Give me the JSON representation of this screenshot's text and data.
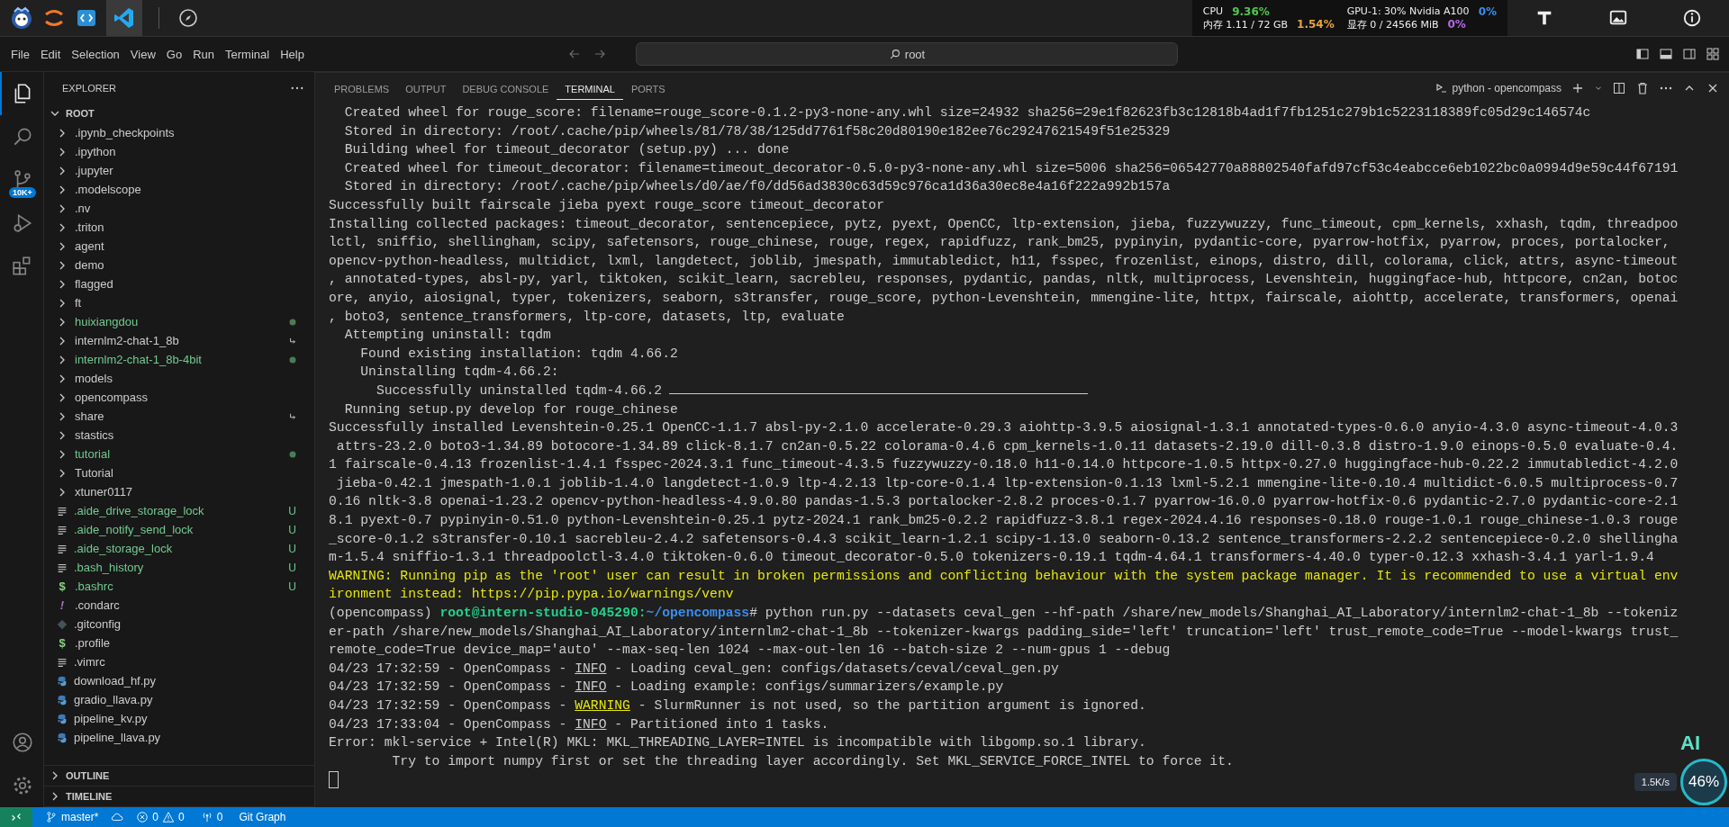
{
  "top_bar": {
    "stats": [
      {
        "label": "CPU",
        "value": "9.36%",
        "color": "#4ec94e"
      },
      {
        "label": "GPU-1: 30% Nvidia A100",
        "value": "0%",
        "color": "#3b8eea"
      },
      {
        "label": "内存 1.11 / 72 GB",
        "value": "1.54%",
        "color": "#e8a33d"
      },
      {
        "label": "显存 0 / 24566 MiB",
        "value": "0%",
        "color": "#b36ae2"
      }
    ]
  },
  "menu": [
    "File",
    "Edit",
    "Selection",
    "View",
    "Go",
    "Run",
    "Terminal",
    "Help"
  ],
  "command_center": {
    "value": "root"
  },
  "activity_bar": {
    "source_control_badge": "10K+"
  },
  "explorer": {
    "title": "EXPLORER",
    "root": "ROOT",
    "items": [
      {
        "label": ".ipynb_checkpoints",
        "kind": "folder",
        "modified": false
      },
      {
        "label": ".ipython",
        "kind": "folder",
        "modified": false
      },
      {
        "label": ".jupyter",
        "kind": "folder",
        "modified": false
      },
      {
        "label": ".modelscope",
        "kind": "folder",
        "modified": false
      },
      {
        "label": ".nv",
        "kind": "folder",
        "modified": false
      },
      {
        "label": ".triton",
        "kind": "folder",
        "modified": false
      },
      {
        "label": "agent",
        "kind": "folder",
        "modified": false
      },
      {
        "label": "demo",
        "kind": "folder",
        "modified": false
      },
      {
        "label": "flagged",
        "kind": "folder",
        "modified": false
      },
      {
        "label": "ft",
        "kind": "folder",
        "modified": false
      },
      {
        "label": "huixiangdou",
        "kind": "folder",
        "modified": true
      },
      {
        "label": "internlm2-chat-1_8b",
        "kind": "folder",
        "modified": false,
        "symlink": true
      },
      {
        "label": "internlm2-chat-1_8b-4bit",
        "kind": "folder",
        "modified": true
      },
      {
        "label": "models",
        "kind": "folder",
        "modified": false
      },
      {
        "label": "opencompass",
        "kind": "folder",
        "modified": false
      },
      {
        "label": "share",
        "kind": "folder",
        "modified": false,
        "symlink": true
      },
      {
        "label": "stastics",
        "kind": "folder",
        "modified": false
      },
      {
        "label": "tutorial",
        "kind": "folder",
        "modified": true
      },
      {
        "label": "Tutorial",
        "kind": "folder",
        "modified": false
      },
      {
        "label": "xtuner0117",
        "kind": "folder",
        "modified": false
      },
      {
        "label": ".aide_drive_storage_lock",
        "kind": "text",
        "modified": true,
        "badge": "U"
      },
      {
        "label": ".aide_notify_send_lock",
        "kind": "text",
        "modified": true,
        "badge": "U"
      },
      {
        "label": ".aide_storage_lock",
        "kind": "text",
        "modified": true,
        "badge": "U"
      },
      {
        "label": ".bash_history",
        "kind": "text",
        "modified": true,
        "badge": "U"
      },
      {
        "label": ".bashrc",
        "kind": "shell",
        "glyph": "$",
        "modified": true,
        "badge": "U"
      },
      {
        "label": ".condarc",
        "kind": "config",
        "glyph": "!",
        "modified": false
      },
      {
        "label": ".gitconfig",
        "kind": "git",
        "modified": false
      },
      {
        "label": ".profile",
        "kind": "shell",
        "glyph": "$",
        "modified": false
      },
      {
        "label": ".vimrc",
        "kind": "text",
        "modified": false
      },
      {
        "label": "download_hf.py",
        "kind": "python",
        "modified": false
      },
      {
        "label": "gradio_llava.py",
        "kind": "python",
        "modified": false
      },
      {
        "label": "pipeline_kv.py",
        "kind": "python",
        "modified": false
      },
      {
        "label": "pipeline_llava.py",
        "kind": "python",
        "modified": false
      }
    ],
    "sections": [
      "OUTLINE",
      "TIMELINE"
    ]
  },
  "panel": {
    "tabs": [
      {
        "label": "PROBLEMS",
        "selected": false
      },
      {
        "label": "OUTPUT",
        "selected": false
      },
      {
        "label": "DEBUG CONSOLE",
        "selected": false
      },
      {
        "label": "TERMINAL",
        "selected": true
      },
      {
        "label": "PORTS",
        "selected": false
      }
    ],
    "terminal_name": "python - opencompass"
  },
  "terminal": {
    "lines": [
      {
        "kind": "plain",
        "text": "  Created wheel for rouge_score: filename=rouge_score-0.1.2-py3-none-any.whl size=24932 sha256=29e1f82623fb3c12818b4ad1f7fb1251c279b1c5223118389fc05d29c146574c"
      },
      {
        "kind": "plain",
        "text": "  Stored in directory: /root/.cache/pip/wheels/81/78/38/125dd7761f58c20d80190e182ee76c29247621549f51e25329"
      },
      {
        "kind": "plain",
        "text": "  Building wheel for timeout_decorator (setup.py) ... done"
      },
      {
        "kind": "plain",
        "text": "  Created wheel for timeout_decorator: filename=timeout_decorator-0.5.0-py3-none-any.whl size=5006 sha256=06542770a88802540fafd97cf53c4eabcce6eb1022bc0a0994d9e59c44f67191"
      },
      {
        "kind": "plain",
        "text": "  Stored in directory: /root/.cache/pip/wheels/d0/ae/f0/dd56ad3830c63d59c976ca1d36a30ec8e4a16f222a992b157a"
      },
      {
        "kind": "plain",
        "text": "Successfully built fairscale jieba pyext rouge_score timeout_decorator"
      },
      {
        "kind": "plain",
        "text": "Installing collected packages: timeout_decorator, sentencepiece, pytz, pyext, OpenCC, ltp-extension, jieba, fuzzywuzzy, func_timeout, cpm_kernels, xxhash, tqdm, threadpoo"
      },
      {
        "kind": "plain",
        "text": "lctl, sniffio, shellingham, scipy, safetensors, rouge_chinese, rouge, regex, rapidfuzz, rank_bm25, pypinyin, pydantic-core, pyarrow-hotfix, pyarrow, proces, portalocker,"
      },
      {
        "kind": "plain",
        "text": "opencv-python-headless, multidict, lxml, langdetect, joblib, jmespath, immutabledict, h11, fsspec, frozenlist, einops, distro, dill, colorama, click, attrs, async-timeout"
      },
      {
        "kind": "plain",
        "text": ", annotated-types, absl-py, yarl, tiktoken, scikit_learn, sacrebleu, responses, pydantic, pandas, nltk, multiprocess, Levenshtein, huggingface-hub, httpcore, cn2an, botoc"
      },
      {
        "kind": "plain",
        "text": "ore, anyio, aiosignal, typer, tokenizers, seaborn, s3transfer, rouge_score, python-Levenshtein, mmengine-lite, httpx, fairscale, aiohttp, accelerate, transformers, openai"
      },
      {
        "kind": "plain",
        "text": ", boto3, sentence_transformers, ltp-core, datasets, ltp, evaluate"
      },
      {
        "kind": "plain",
        "text": "  Attempting uninstall: tqdm"
      },
      {
        "kind": "plain",
        "text": "    Found existing installation: tqdm 4.66.2"
      },
      {
        "kind": "plain",
        "text": "    Uninstalling tqdm-4.66.2:"
      },
      {
        "kind": "plain",
        "text": "      Successfully uninstalled tqdm-4.66.2",
        "trailing_rule": true
      },
      {
        "kind": "plain",
        "text": "  Running setup.py develop for rouge_chinese"
      },
      {
        "kind": "plain",
        "text": "Successfully installed Levenshtein-0.25.1 OpenCC-1.1.7 absl-py-2.1.0 accelerate-0.29.3 aiohttp-3.9.5 aiosignal-1.3.1 annotated-types-0.6.0 anyio-4.3.0 async-timeout-4.0.3"
      },
      {
        "kind": "plain",
        "text": " attrs-23.2.0 boto3-1.34.89 botocore-1.34.89 click-8.1.7 cn2an-0.5.22 colorama-0.4.6 cpm_kernels-1.0.11 datasets-2.19.0 dill-0.3.8 distro-1.9.0 einops-0.5.0 evaluate-0.4."
      },
      {
        "kind": "plain",
        "text": "1 fairscale-0.4.13 frozenlist-1.4.1 fsspec-2024.3.1 func_timeout-4.3.5 fuzzywuzzy-0.18.0 h11-0.14.0 httpcore-1.0.5 httpx-0.27.0 huggingface-hub-0.22.2 immutabledict-4.2.0"
      },
      {
        "kind": "plain",
        "text": " jieba-0.42.1 jmespath-1.0.1 joblib-1.4.0 langdetect-1.0.9 ltp-4.2.13 ltp-core-0.1.4 ltp-extension-0.1.13 lxml-5.2.1 mmengine-lite-0.10.4 multidict-6.0.5 multiprocess-0.7"
      },
      {
        "kind": "plain",
        "text": "0.16 nltk-3.8 openai-1.23.2 opencv-python-headless-4.9.0.80 pandas-1.5.3 portalocker-2.8.2 proces-0.1.7 pyarrow-16.0.0 pyarrow-hotfix-0.6 pydantic-2.7.0 pydantic-core-2.1"
      },
      {
        "kind": "plain",
        "text": "8.1 pyext-0.7 pypinyin-0.51.0 python-Levenshtein-0.25.1 pytz-2024.1 rank_bm25-0.2.2 rapidfuzz-3.8.1 regex-2024.4.16 responses-0.18.0 rouge-1.0.1 rouge_chinese-1.0.3 rouge"
      },
      {
        "kind": "plain",
        "text": "_score-0.1.2 s3transfer-0.10.1 sacrebleu-2.4.2 safetensors-0.4.3 scikit_learn-1.2.1 scipy-1.13.0 seaborn-0.13.2 sentence_transformers-2.2.2 sentencepiece-0.2.0 shellingha"
      },
      {
        "kind": "plain",
        "text": "m-1.5.4 sniffio-1.3.1 threadpoolctl-3.4.0 tiktoken-0.6.0 timeout_decorator-0.5.0 tokenizers-0.19.1 tqdm-4.64.1 transformers-4.40.0 typer-0.12.3 xxhash-3.4.1 yarl-1.9.4"
      },
      {
        "kind": "warning",
        "text": "WARNING: Running pip as the 'root' user can result in broken permissions and conflicting behaviour with the system package manager. It is recommended to use a virtual env"
      },
      {
        "kind": "warning",
        "text": "ironment instead: https://pip.pypa.io/warnings/venv"
      },
      {
        "kind": "prompt",
        "env": "(opencompass)",
        "user_host": "root@intern-studio-045290:",
        "path": "~/opencompass",
        "command": "# python run.py --datasets ceval_gen --hf-path /share/new_models/Shanghai_AI_Laboratory/internlm2-chat-1_8b --tokeniz"
      },
      {
        "kind": "plain",
        "text": "er-path /share/new_models/Shanghai_AI_Laboratory/internlm2-chat-1_8b --tokenizer-kwargs padding_side='left' truncation='left' trust_remote_code=True --model-kwargs trust_"
      },
      {
        "kind": "plain",
        "text": "remote_code=True device_map='auto' --max-seq-len 1024 --max-out-len 16 --batch-size 2 --num-gpus 1 --debug"
      },
      {
        "kind": "log",
        "prefix": "04/23 17:32:59 - OpenCompass - ",
        "level": "INFO",
        "message": " - Loading ceval_gen: configs/datasets/ceval/ceval_gen.py"
      },
      {
        "kind": "log",
        "prefix": "04/23 17:32:59 - OpenCompass - ",
        "level": "INFO",
        "message": " - Loading example: configs/summarizers/example.py"
      },
      {
        "kind": "log",
        "prefix": "04/23 17:32:59 - OpenCompass - ",
        "level": "WARNING",
        "message": " - SlurmRunner is not used, so the partition argument is ignored."
      },
      {
        "kind": "log",
        "prefix": "04/23 17:33:04 - OpenCompass - ",
        "level": "INFO",
        "message": " - Partitioned into 1 tasks."
      },
      {
        "kind": "plain",
        "text": "Error: mkl-service + Intel(R) MKL: MKL_THREADING_LAYER=INTEL is incompatible with libgomp.so.1 library."
      },
      {
        "kind": "plain",
        "text": "        Try to import numpy first or set the threading layer accordingly. Set MKL_SERVICE_FORCE_INTEL to force it."
      },
      {
        "kind": "cursor"
      }
    ]
  },
  "overlay_widget": {
    "ai_label": "AI",
    "upload": "1.5K/s",
    "percent": "46%"
  },
  "status_bar": {
    "branch": "master*",
    "errors": "0",
    "warnings": "0",
    "ports": "0",
    "extension": "Git Graph"
  }
}
